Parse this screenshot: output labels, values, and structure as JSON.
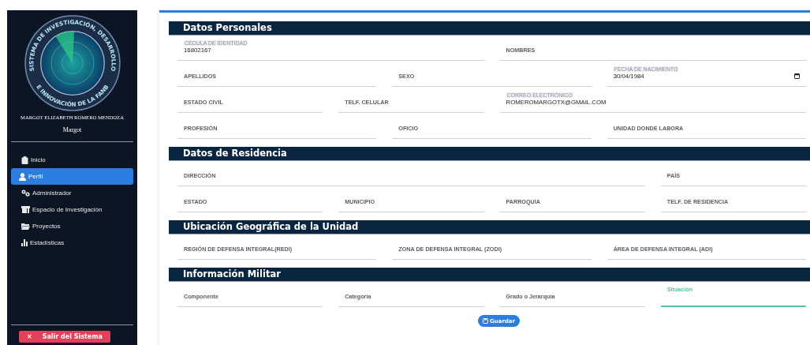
{
  "sidebar": {
    "logo_text_top": "SISTEMA DE INVESTIGACIÓN, DESARROLLO",
    "logo_text_bottom": "E INNOVACIÓN DE LA FANB",
    "full_name": "MARGOT ELIZABETH ROMERO MENDOZA",
    "username": "Margot",
    "nav_items": [
      {
        "label": "Inicio",
        "selected": false
      },
      {
        "label": "Perfil",
        "selected": true
      },
      {
        "label": "Administrador",
        "selected": false
      },
      {
        "label": "Espacio de Investigación",
        "selected": false
      },
      {
        "label": "Proyectos",
        "selected": false
      },
      {
        "label": "Estadísticas",
        "selected": false
      }
    ],
    "logout_button": {
      "icon": "×",
      "label": "Salir del Sistema"
    }
  },
  "sections": [
    {
      "title": "Datos Personales",
      "rows": [
        {
          "fields": [
            {
              "kind": "filled",
              "label": "CÉDULA DE IDENTIDAD",
              "value": "16802167",
              "focused": false
            },
            {
              "kind": "plain",
              "label": "NOMBRES",
              "focused": false
            }
          ]
        },
        {
          "fields": [
            {
              "kind": "plain",
              "label": "APELLIDOS",
              "focused": false
            },
            {
              "kind": "plain",
              "label": "SEXO",
              "focused": false
            },
            {
              "kind": "date",
              "label": "FECHA DE NACIMIENTO",
              "value": "30/04/1984",
              "focused": false
            }
          ]
        },
        {
          "fields": [
            {
              "kind": "plain",
              "label": "ESTADO CIVIL",
              "focused": false
            },
            {
              "kind": "plain",
              "label": "TELF. CELULAR",
              "focused": false
            },
            {
              "kind": "filled",
              "label": "CORREO ELECTRÓNICO",
              "value": "ROMEROMARGOTX@GMAIL.COM",
              "focused": false
            }
          ]
        },
        {
          "fields": [
            {
              "kind": "plain",
              "label": "PROFESIÓN",
              "focused": false
            },
            {
              "kind": "plain",
              "label": "OFICIO",
              "focused": false
            },
            {
              "kind": "plain",
              "label": "UNIDAD DONDE LABORA",
              "focused": false
            }
          ]
        }
      ]
    },
    {
      "title": "Datos de Residencia",
      "rows": [
        {
          "fields": [
            {
              "kind": "plain",
              "label": "DIRECCIÓN",
              "focused": false
            },
            {
              "kind": "plain",
              "label": "PAÍS",
              "focused": false
            }
          ]
        },
        {
          "fields": [
            {
              "kind": "plain",
              "label": "ESTADO",
              "focused": false
            },
            {
              "kind": "plain",
              "label": "MUNICIPIO",
              "focused": false
            },
            {
              "kind": "plain",
              "label": "PARROQUIA",
              "focused": false
            },
            {
              "kind": "plain",
              "label": "TELF. DE RESIDENCIA",
              "focused": false
            }
          ]
        }
      ]
    },
    {
      "title": "Ubicación Geográfica de la Unidad",
      "rows": [
        {
          "fields": [
            {
              "kind": "plain",
              "label": "REGIÓN DE DEFENSA INTEGRAL(REDI)",
              "focused": false
            },
            {
              "kind": "plain",
              "label": "ZONA DE DEFENSA INTEGRAL (ZODI)",
              "focused": false
            },
            {
              "kind": "plain",
              "label": "ÁREA DE DEFENSA INTEGRAL (ADI)",
              "focused": false
            }
          ]
        }
      ]
    },
    {
      "title": "Información Militar",
      "rows": [
        {
          "fields": [
            {
              "kind": "plain",
              "label": "Componente",
              "focused": false
            },
            {
              "kind": "plain",
              "label": "Categoría",
              "focused": false
            },
            {
              "kind": "plain",
              "label": "Grado o Jerarquía",
              "focused": false
            },
            {
              "kind": "plain",
              "label": "Situación",
              "focused": true
            }
          ]
        }
      ]
    }
  ],
  "save_button": {
    "label": "Guardar"
  }
}
